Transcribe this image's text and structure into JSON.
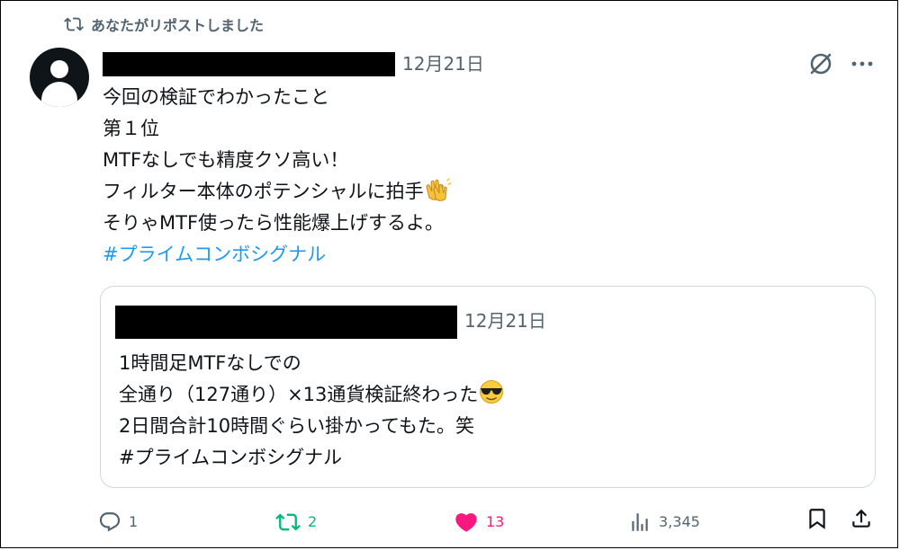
{
  "repost_banner": {
    "text": "あなたがリポストしました",
    "icon": "repost-icon"
  },
  "post": {
    "date": "12月21日",
    "lines": [
      "今回の検証でわかったこと",
      "第１位",
      "MTFなしでも精度クソ高い！",
      "フィルター本体のポテンシャルに拍手",
      "そりゃMTF使ったら性能爆上げするよ。"
    ],
    "line4_emoji": "clapping-hands-emoji",
    "hashtag": "#プライムコンボシグナル"
  },
  "quote": {
    "date": "12月21日",
    "lines": [
      "1時間足MTFなしでの",
      "全通り（127通り）×13通貨検証終わった",
      "2日間合計10時間ぐらい掛かってもた。笑",
      "#プライムコンボシグナル"
    ],
    "line2_emoji": "sunglasses-emoji"
  },
  "actions": {
    "reply_count": "1",
    "repost_count": "2",
    "like_count": "13",
    "views_count": "3,345"
  },
  "colors": {
    "accent": "#1d9bf0",
    "repost_active": "#00ba7c",
    "like_active": "#f91880",
    "muted": "#536471"
  }
}
